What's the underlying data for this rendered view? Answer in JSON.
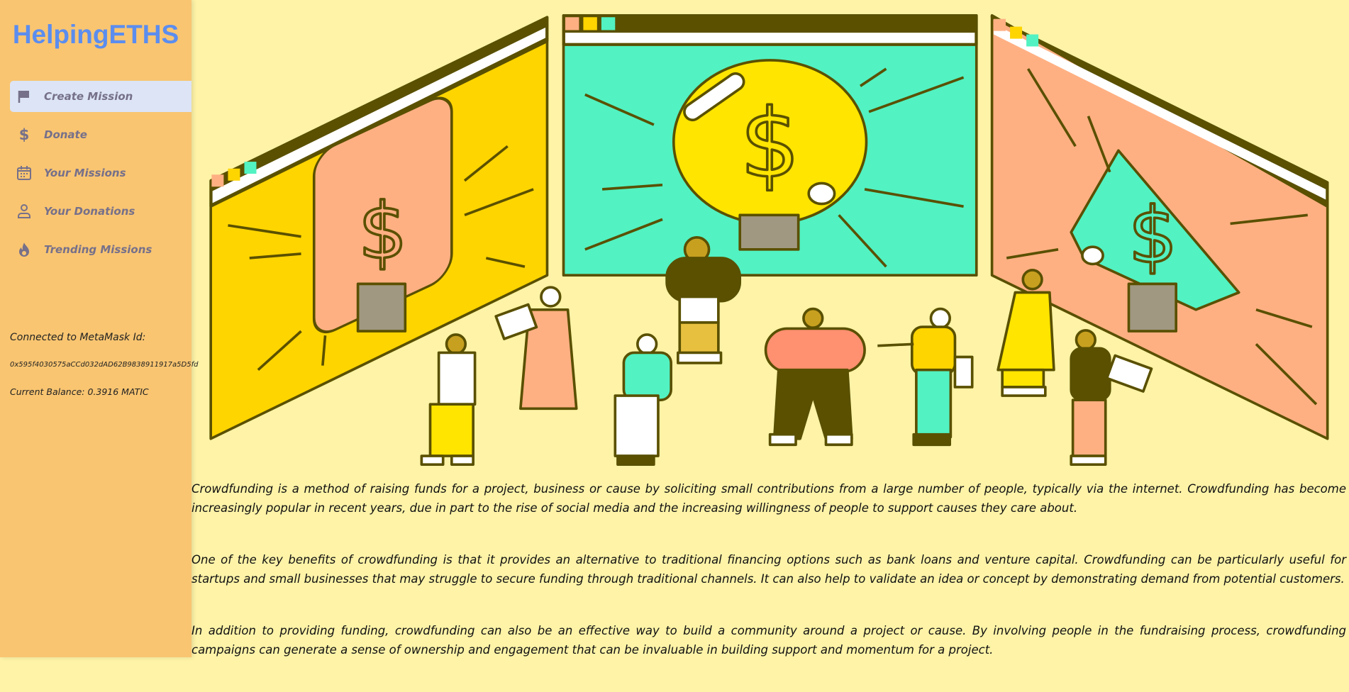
{
  "sidebar": {
    "brand": "HelpingETHS",
    "items": [
      {
        "label": "Create Mission",
        "icon": "flag-icon",
        "active": true
      },
      {
        "label": "Donate",
        "icon": "dollar-icon"
      },
      {
        "label": "Your Missions",
        "icon": "calendar-icon"
      },
      {
        "label": "Your Donations",
        "icon": "user-icon"
      },
      {
        "label": "Trending Missions",
        "icon": "fire-icon"
      }
    ],
    "connected_label": "Connected to MetaMask Id:",
    "wallet_id": "0x595f4030575aCCd032dAD62B9838911917a5D5fd",
    "balance": "Current Balance: 0.3916 MATIC"
  },
  "colors": {
    "sidebar": "#F9C571",
    "main": "#FEF3A7",
    "brand": "#5B8DEF",
    "active": "#DCE4F5",
    "outline": "#5A5000",
    "yellow": "#FFD500",
    "teal": "#52F2C2",
    "salmon": "#FFB083"
  },
  "main": {
    "paragraphs": [
      "Crowdfunding is a method of raising funds for a project, business or cause by soliciting small contributions from a large number of people, typically via the internet. Crowdfunding has become increasingly popular in recent years, due in part to the rise of social media and the increasing willingness of people to support causes they care about.",
      "One of the key benefits of crowdfunding is that it provides an alternative to traditional financing options such as bank loans and venture capital. Crowdfunding can be particularly useful for startups and small businesses that may struggle to secure funding through traditional channels. It can also help to validate an idea or concept by demonstrating demand from potential customers.",
      "In addition to providing funding, crowdfunding can also be an effective way to build a community around a project or cause. By involving people in the fundraising process, crowdfunding campaigns can generate a sense of ownership and engagement that can be invaluable in building support and momentum for a project."
    ]
  }
}
